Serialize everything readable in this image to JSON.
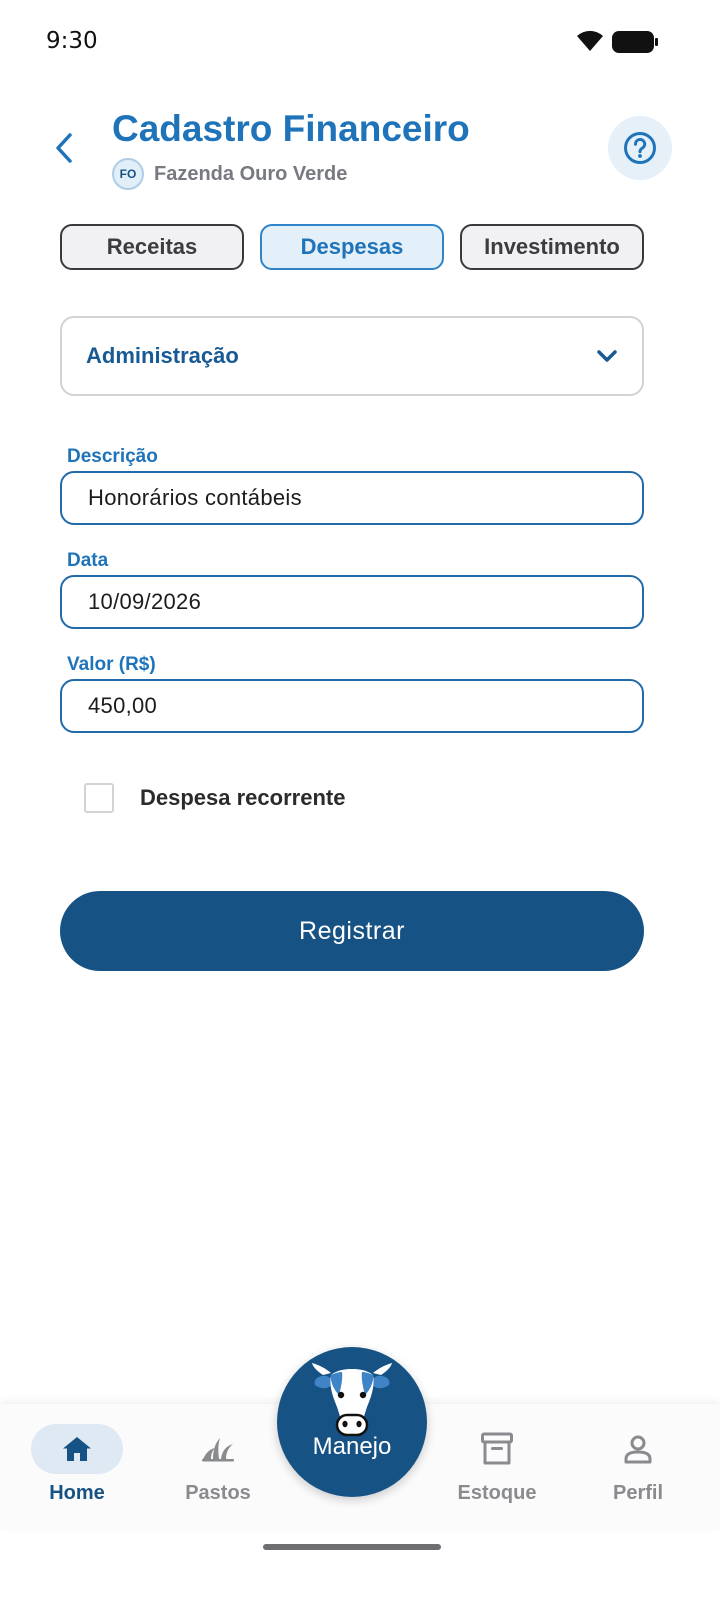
{
  "status_bar": {
    "time": "9:30"
  },
  "header": {
    "title": "Cadastro Financeiro",
    "farm_initials": "FO",
    "farm_name": "Fazenda Ouro Verde"
  },
  "tabs": [
    {
      "label": "Receitas",
      "active": false
    },
    {
      "label": "Despesas",
      "active": true
    },
    {
      "label": "Investimento",
      "active": false
    }
  ],
  "category_select": {
    "value": "Administração"
  },
  "form": {
    "description": {
      "label": "Descrição",
      "value": "Honorários contábeis"
    },
    "date": {
      "label": "Data",
      "value": "10/09/2026"
    },
    "amount": {
      "label": "Valor (R$)",
      "value": "450,00"
    },
    "recurring": {
      "label": "Despesa recorrente",
      "checked": false
    },
    "submit_label": "Registrar"
  },
  "bottom_nav": {
    "items": [
      {
        "label": "Home",
        "icon": "home-icon",
        "active": true
      },
      {
        "label": "Pastos",
        "icon": "grass-icon",
        "active": false
      },
      {
        "label": "Estoque",
        "icon": "archive-icon",
        "active": false
      },
      {
        "label": "Perfil",
        "icon": "person-icon",
        "active": false
      }
    ],
    "center": {
      "label": "Manejo",
      "icon": "cow-icon"
    }
  },
  "colors": {
    "primary": "#1f74b9",
    "primary_dark": "#175285",
    "tab_active_bg": "#e3eff9",
    "muted_text": "#8a8b8f"
  }
}
